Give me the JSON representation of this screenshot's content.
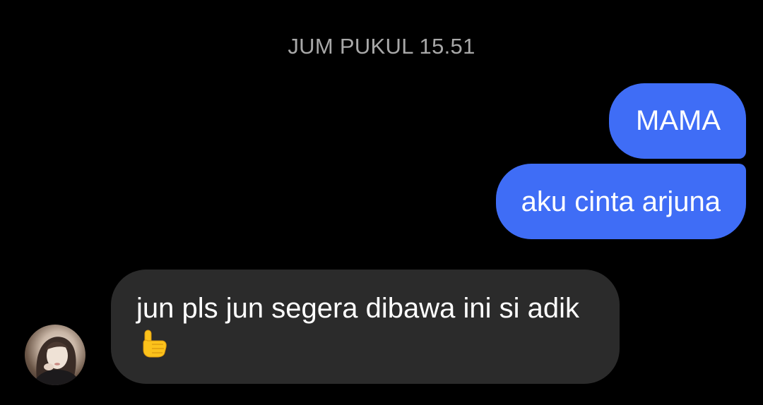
{
  "chat": {
    "timestamp": "JUM PUKUL 15.51",
    "messages": [
      {
        "direction": "outgoing",
        "text": "MAMA"
      },
      {
        "direction": "outgoing",
        "text": "aku cinta arjuna"
      },
      {
        "direction": "incoming",
        "text": "jun pls jun segera dibawa ini si adik"
      }
    ],
    "incoming_emoji": "pointing-up-hand-emoji"
  },
  "colors": {
    "background": "#000000",
    "outgoing_bubble": "#3f6df6",
    "incoming_bubble": "#2b2b2b",
    "timestamp_text": "#a8a8a8",
    "message_text": "#ffffff"
  },
  "icons": {
    "avatar": "contact-avatar"
  }
}
